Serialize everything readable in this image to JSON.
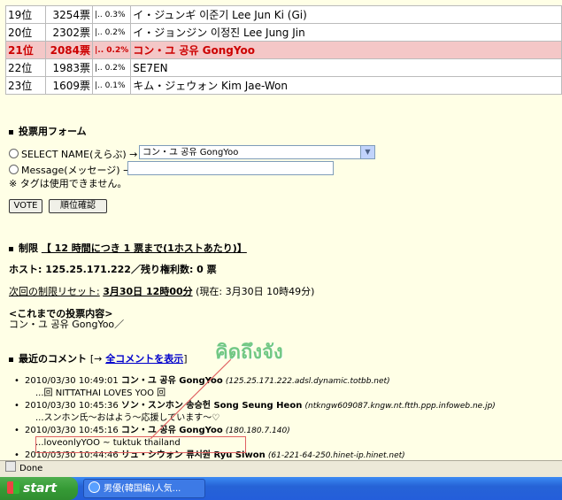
{
  "ranking": [
    {
      "pos": "19位",
      "votes": "3254票",
      "pct": "0.3%",
      "name": "イ・ジュンギ  이준기  Lee Jun Ki (Gi)",
      "highlight": false
    },
    {
      "pos": "20位",
      "votes": "2302票",
      "pct": "0.2%",
      "name": "イ・ジョンジン 이정진 Lee Jung Jin",
      "highlight": false
    },
    {
      "pos": "21位",
      "votes": "2084票",
      "pct": "0.2%",
      "name": "コン・ユ  공유  GongYoo",
      "highlight": true
    },
    {
      "pos": "22位",
      "votes": "1983票",
      "pct": "0.2%",
      "name": "SE7EN",
      "highlight": false
    },
    {
      "pos": "23位",
      "votes": "1609票",
      "pct": "0.1%",
      "name": "キム・ジェウォン  Kim Jae-Won",
      "highlight": false
    }
  ],
  "form": {
    "title": "投票用フォーム",
    "select_label": "SELECT NAME(えらぶ) →",
    "select_value": "コン・ユ  공유  GongYoo",
    "message_label": "Message(メッセージ) →",
    "note": "※ タグは使用できません。",
    "vote_button": "VOTE",
    "rank_button": "順位確認"
  },
  "limit": {
    "title": "制限",
    "rule": "【 12 時間につき 1 票まで(1ホストあたり)】",
    "host_line": "ホスト: 125.25.171.222／残り権利数: 0 票",
    "reset_label": "次回の制限リセット:",
    "reset_time": "3月30日 12時00分",
    "now": "(現在: 3月30日 10時49分)",
    "history_title": "<これまでの投票内容>",
    "history_value": "コン・ユ  공유  GongYoo／"
  },
  "comments": {
    "title": "最近のコメント",
    "bracket_open": "[→",
    "all_link": "全コメントを表示",
    "bracket_close": "]",
    "items": [
      {
        "time": "2010/03/30 10:49:01",
        "name": "コン・ユ  공유  GongYoo",
        "host": "(125.25.171.222.adsl.dynamic.totbb.net)",
        "msg": "...回 NITTATHAI LOVES YOO 回"
      },
      {
        "time": "2010/03/30 10:45:36",
        "name": "ソン・スンホン  송승헌  Song Seung Heon",
        "host": "(ntkngw609087.kngw.nt.ftth.ppp.infoweb.ne.jp)",
        "msg": "...スンホン氏〜おはよう〜応援しています〜♡"
      },
      {
        "time": "2010/03/30 10:45:16",
        "name": "コン・ユ  공유  GongYoo",
        "host": "(180.180.7.140)",
        "msg": "...loveonlyYOO ~ tuktuk thailand"
      },
      {
        "time": "2010/03/30 10:44:46",
        "name": "リュ・シウォン  류시원  Ryu Siwon",
        "host": "(61-221-64-250.hinet-ip.hinet.net)",
        "msg": ""
      }
    ]
  },
  "annotation": "คิดถึงจัง",
  "status": "Done",
  "taskbar": {
    "start": "start",
    "task": "男優(韓国編)人気..."
  }
}
